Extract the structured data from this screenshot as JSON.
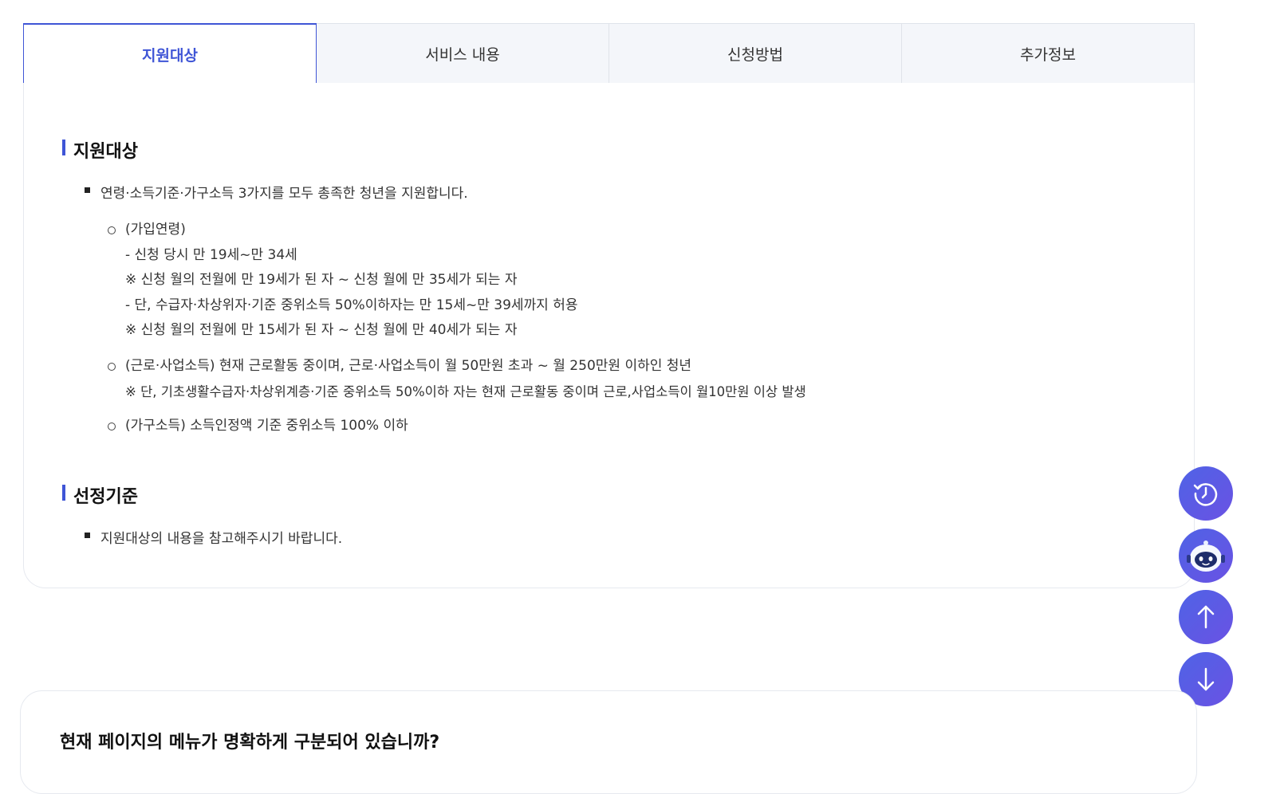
{
  "tabs": [
    {
      "label": "지원대상"
    },
    {
      "label": "서비스 내용"
    },
    {
      "label": "신청방법"
    },
    {
      "label": "추가정보"
    }
  ],
  "section1": {
    "title": "지원대상",
    "bullet": "연령·소득기준·가구소득 3가지를 모두 총족한 청년을 지원합니다.",
    "items": [
      {
        "lines": [
          "(가입연령)",
          "- 신청 당시 만 19세~만 34세",
          "※ 신청 월의 전월에 만 19세가 된 자 ~ 신청 월에 만 35세가 되는 자",
          "- 단, 수급자·차상위자·기준 중위소득 50%이하자는 만 15세~만 39세까지 허용",
          "※ 신청 월의 전월에 만 15세가 된 자 ~ 신청 월에 만 40세가 되는 자"
        ]
      },
      {
        "lines": [
          "(근로·사업소득) 현재 근로활동 중이며, 근로·사업소득이 월 50만원 초과 ~ 월 250만원 이하인 청년",
          "※ 단, 기초생활수급자·차상위계층·기준 중위소득 50%이하 자는 현재 근로활동 중이며 근로,사업소득이 월10만원 이상 발생"
        ]
      },
      {
        "lines": [
          "(가구소득) 소득인정액 기준 중위소득 100% 이하"
        ]
      }
    ]
  },
  "section2": {
    "title": "선정기준",
    "bullet": "지원대상의 내용을 참고해주시기 바랍니다."
  },
  "survey": {
    "question": "현재 페이지의 메뉴가 명확하게 구분되어 있습니까?"
  },
  "floating": {
    "history": "history-icon",
    "chatbot": "chatbot-icon",
    "up": "arrow-up-icon",
    "down": "arrow-down-icon"
  },
  "colors": {
    "accent": "#3f55d6",
    "fab": "#5a5be5"
  }
}
